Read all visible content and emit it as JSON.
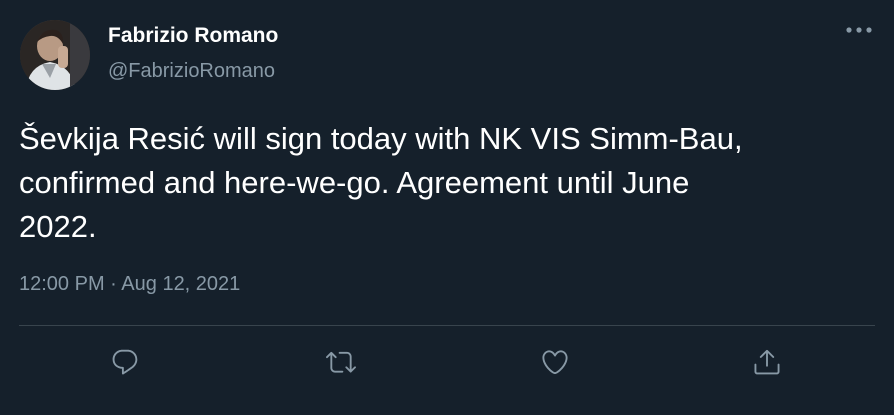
{
  "author": {
    "name": "Fabrizio Romano",
    "handle": "@FabrizioRomano"
  },
  "tweet": {
    "text": "Ševkija Resić will sign today with NK VIS Simm-Bau,\nconfirmed and here-we-go. Agreement until June\n2022.",
    "time": "12:00 PM",
    "separator": "·",
    "date": "Aug 12, 2021"
  },
  "icons": {
    "more": "more-horizontal-icon",
    "reply": "reply-icon",
    "retweet": "retweet-icon",
    "like": "heart-icon",
    "share": "share-icon"
  },
  "colors": {
    "background": "#15202b",
    "text": "#ffffff",
    "secondary": "#8899a6",
    "divider": "#38444d"
  }
}
